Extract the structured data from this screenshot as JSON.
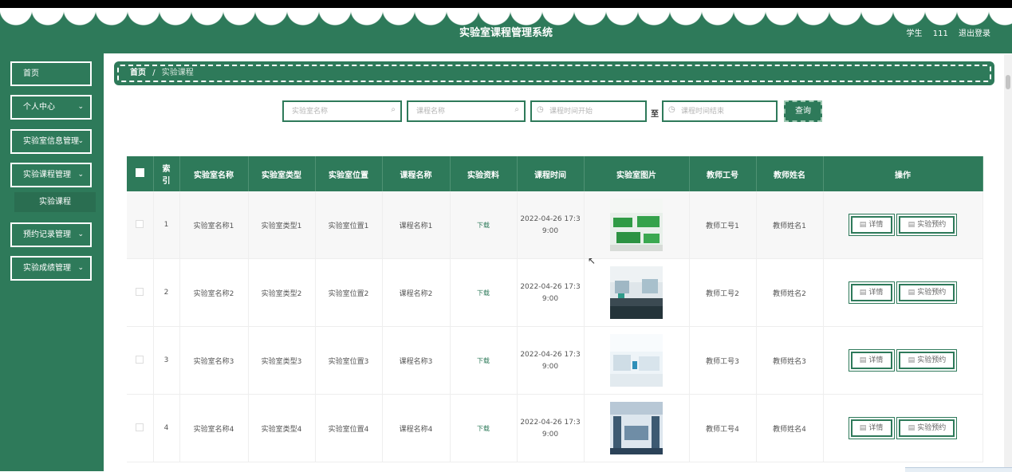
{
  "header": {
    "title": "实验室课程管理系统",
    "user_role": "学生",
    "user_name": "111",
    "logout_label": "退出登录"
  },
  "sidebar": {
    "items": [
      {
        "label": "首页",
        "has_chevron": false
      },
      {
        "label": "个人中心",
        "has_chevron": true
      },
      {
        "label": "实验室信息管理",
        "has_chevron": true
      },
      {
        "label": "实验课程管理",
        "has_chevron": true
      },
      {
        "label": "预约记录管理",
        "has_chevron": true
      },
      {
        "label": "实验成绩管理",
        "has_chevron": true
      }
    ],
    "sub_item": {
      "label": "实验课程"
    },
    "chevron_glyph": "⌄"
  },
  "breadcrumb": {
    "home": "首页",
    "separator": "/",
    "current": "实验课程"
  },
  "search": {
    "lab_name_placeholder": "实验室名称",
    "course_name_placeholder": "课程名称",
    "time_start_placeholder": "课程时间开始",
    "time_end_placeholder": "课程时间结束",
    "to_label": "至",
    "query_label": "查询"
  },
  "table": {
    "headers": {
      "index": "索引",
      "lab_name": "实验室名称",
      "lab_type": "实验室类型",
      "lab_location": "实验室位置",
      "course_name": "课程名称",
      "material": "实验资料",
      "course_time": "课程时间",
      "lab_image": "实验室图片",
      "teacher_id": "教师工号",
      "teacher_name": "教师姓名",
      "actions": "操作"
    },
    "rows": [
      {
        "index": "1",
        "lab_name": "实验室名称1",
        "lab_type": "实验室类型1",
        "lab_location": "实验室位置1",
        "course_name": "课程名称1",
        "material": "下载",
        "course_time_line1": "2022-04-26 17:3",
        "course_time_line2": "9:00",
        "teacher_id": "教师工号1",
        "teacher_name": "教师姓名1",
        "detail_label": "详情",
        "book_label": "实验预约"
      },
      {
        "index": "2",
        "lab_name": "实验室名称2",
        "lab_type": "实验室类型2",
        "lab_location": "实验室位置2",
        "course_name": "课程名称2",
        "material": "下载",
        "course_time_line1": "2022-04-26 17:3",
        "course_time_line2": "9:00",
        "teacher_id": "教师工号2",
        "teacher_name": "教师姓名2",
        "detail_label": "详情",
        "book_label": "实验预约"
      },
      {
        "index": "3",
        "lab_name": "实验室名称3",
        "lab_type": "实验室类型3",
        "lab_location": "实验室位置3",
        "course_name": "课程名称3",
        "material": "下载",
        "course_time_line1": "2022-04-26 17:3",
        "course_time_line2": "9:00",
        "teacher_id": "教师工号3",
        "teacher_name": "教师姓名3",
        "detail_label": "详情",
        "book_label": "实验预约"
      },
      {
        "index": "4",
        "lab_name": "实验室名称4",
        "lab_type": "实验室类型4",
        "lab_location": "实验室位置4",
        "course_name": "课程名称4",
        "material": "下载",
        "course_time_line1": "2022-04-26 17:3",
        "course_time_line2": "9:00",
        "teacher_id": "教师工号4",
        "teacher_name": "教师姓名4",
        "detail_label": "详情",
        "book_label": "实验预约"
      }
    ]
  },
  "icons": {
    "search": "search-icon",
    "clock": "clock-icon",
    "document": "document-icon",
    "cursor": "mouse-cursor-icon"
  },
  "colors": {
    "primary": "#2e7a5a",
    "sidebar_sub": "#2a6e51",
    "row_highlight": "#f7f7f7"
  }
}
